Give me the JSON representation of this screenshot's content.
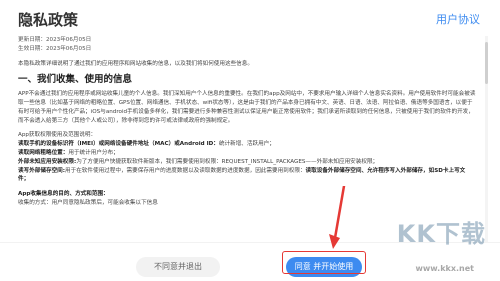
{
  "header": {
    "title": "隐私政策",
    "user_agreement_link": "用户协议"
  },
  "content": {
    "meta": [
      "更新日期：2023年06月05日",
      "生效日期：2023年06月05日"
    ],
    "intro": "本隐私政策详细说明了通过我们的应用程序和网站收集的信息，以及我们将如何使用这些信息。",
    "section1_title": "一、我们收集、使用的信息",
    "section1_para": "APP不会通过我们的应用程序或网站收集儿童的个人信息。我们深知用户个人信息的重要性。在我们的app及网站中，不要求用户输入详细个人信息实名资料。用户使用软件时可能会被读取一些信息（比如基于网络的粗略位置、GPS位置、网络通信、手机状态、wifi状态等），这是由于我们的产品本身已拥有中文、英语、日语、法语、阿拉伯语、俄语等多国语言，以便于有时可给予用户个性化产品；iOS与android手机设备多样化，我们需要进行多种兼容性测试以保证用户能正常使用软件；我们承诺所读取到的任何信息，只被使用于我们的软件的开发，而不会透入给第三方（其他个人或公司），除非得到您的许可或法律或政府的强制规定。",
    "perm_heading": "App获取权限使用及范围说明：",
    "perm_items": [
      {
        "label": "读取手机的设备标识符（IMEI）或网络设备硬件地址（MAC）或Android ID：",
        "desc": "统计新增、活跃用户；"
      },
      {
        "label": "读取网络粗略位置：",
        "desc": "用于统计用户分布；"
      },
      {
        "label": "外部未知应用安装权限:",
        "desc": "为了方便用户快捷获取软件新版本，我们需要使用到权限：REQUEST_INSTALL_PACKAGES——外部未知应用安装权限；"
      },
      {
        "label": "读写外部储存空间:",
        "desc": "用于在软件使用过程中，需要保存用户的进度数据以及读取数据的进度数据，因此需要用到权限："
      },
      {
        "label": "读取设备外部储存空间、允许程序写入外部储存，如SD卡上写文件；",
        "desc": ""
      }
    ],
    "collect_heading": "App收集信息的目的、方式和范围：",
    "collect_text": "收集的方式：用户同意隐私政策后，可能会收集以下信息"
  },
  "footer": {
    "decline_label": "不同意并退出",
    "agree_label": "同意 并开始使用"
  },
  "watermark": {
    "logo": "KK下载",
    "url": "www.kkx.net"
  },
  "colors": {
    "accent": "#3d8bf0",
    "highlight": "#e53935"
  }
}
